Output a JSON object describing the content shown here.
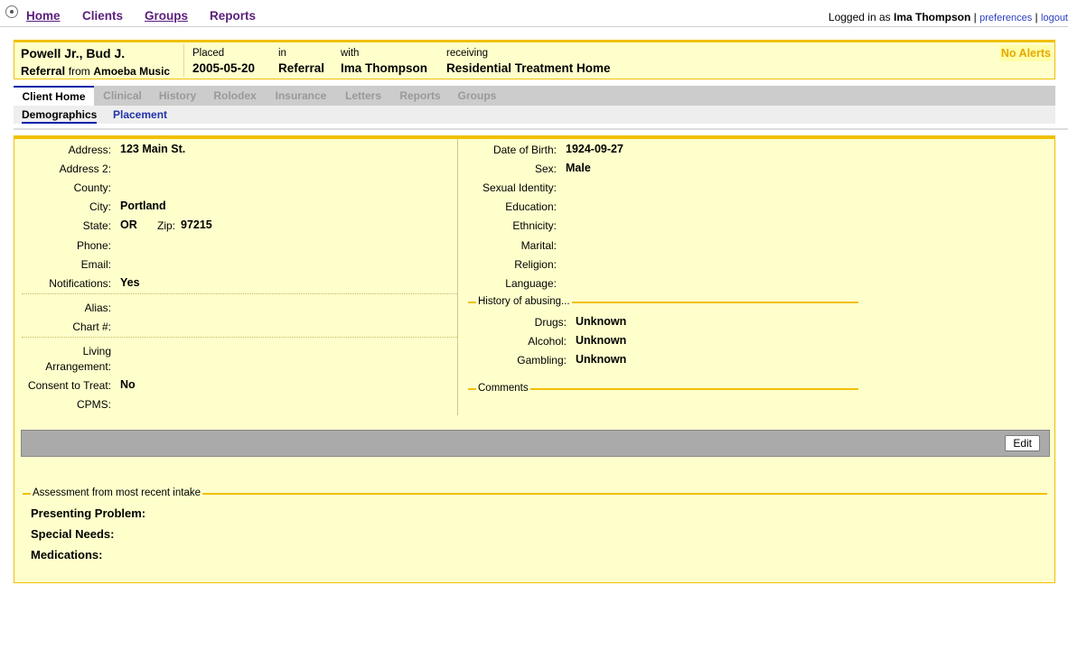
{
  "nav": {
    "home": "Home",
    "clients": "Clients",
    "groups": "Groups",
    "reports": "Reports",
    "logged_in_prefix": "Logged in as",
    "user": "Ima Thompson",
    "preferences": "preferences",
    "logout": "logout"
  },
  "client": {
    "name": "Powell Jr., Bud J.",
    "referral_type": "Referral",
    "referral_from_word": "from",
    "referral_source": "Amoeba Music",
    "placed_label": "Placed",
    "placed_value": "2005-05-20",
    "in_label": "in",
    "in_value": "Referral",
    "with_label": "with",
    "with_value": "Ima Thompson",
    "receiving_label": "receiving",
    "receiving_value": "Residential Treatment Home",
    "alerts": "No Alerts"
  },
  "tabs": [
    "Client Home",
    "Clinical",
    "History",
    "Rolodex",
    "Insurance",
    "Letters",
    "Reports",
    "Groups"
  ],
  "subtabs": [
    "Demographics",
    "Placement"
  ],
  "left": {
    "address_label": "Address:",
    "address": "123 Main St.",
    "address2_label": "Address 2:",
    "county_label": "County:",
    "city_label": "City:",
    "city": "Portland",
    "state_label": "State:",
    "state": "OR",
    "zip_label": "Zip:",
    "zip": "97215",
    "phone_label": "Phone:",
    "email_label": "Email:",
    "notifications_label": "Notifications:",
    "notifications": "Yes",
    "alias_label": "Alias:",
    "chart_label": "Chart #:",
    "living_label_1": "Living",
    "living_label_2": "Arrangement:",
    "consent_label": "Consent to Treat:",
    "consent": "No",
    "cpms_label": "CPMS:"
  },
  "right": {
    "dob_label": "Date of Birth:",
    "dob": "1924-09-27",
    "sex_label": "Sex:",
    "sex": "Male",
    "sexual_identity_label": "Sexual Identity:",
    "education_label": "Education:",
    "ethnicity_label": "Ethnicity:",
    "marital_label": "Marital:",
    "religion_label": "Religion:",
    "language_label": "Language:",
    "abuse_legend": "History of abusing...",
    "drugs_label": "Drugs:",
    "drugs": "Unknown",
    "alcohol_label": "Alcohol:",
    "alcohol": "Unknown",
    "gambling_label": "Gambling:",
    "gambling": "Unknown",
    "comments_legend": "Comments"
  },
  "edit_label": "Edit",
  "assessment": {
    "legend": "Assessment from most recent intake",
    "presenting": "Presenting Problem:",
    "special_needs": "Special Needs:",
    "medications": "Medications:"
  }
}
